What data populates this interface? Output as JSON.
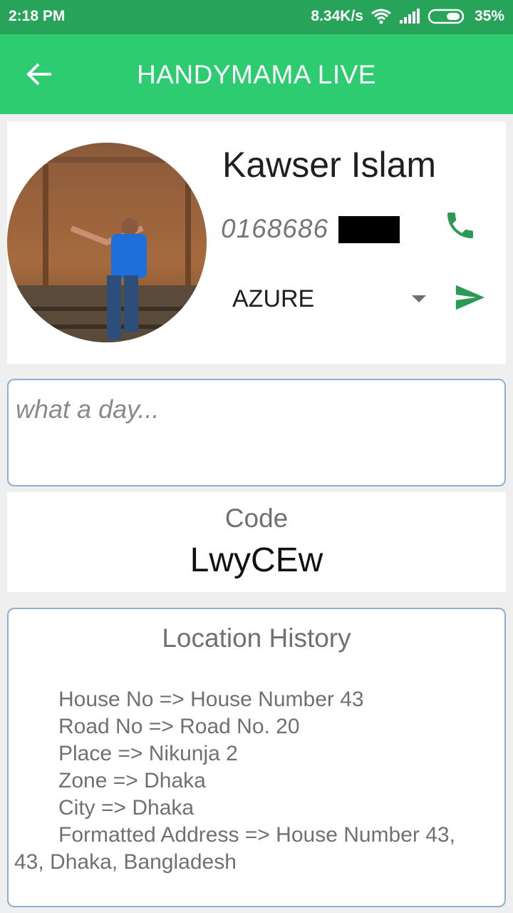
{
  "status_bar": {
    "time": "2:18 PM",
    "network_speed": "8.34K/s",
    "battery": "35%",
    "icons": [
      "wifi-icon",
      "signal-icon",
      "battery-icon"
    ]
  },
  "app_bar": {
    "title": "HANDYMAMA LIVE",
    "back_icon": "arrow-back-icon"
  },
  "profile": {
    "name": "Kawser Islam",
    "phone_visible": "0168686",
    "phone_redacted": true,
    "call_icon": "phone-icon",
    "dropdown_value": "AZURE",
    "send_icon": "send-icon"
  },
  "message": {
    "placeholder": "what a day..."
  },
  "code": {
    "label": "Code",
    "value": "LwyCEw"
  },
  "location_history": {
    "title": "Location History",
    "lines": [
      "House No => House Number 43",
      "Road No => Road No. 20",
      "Place => Nikunja 2",
      "Zone => Dhaka",
      "City => Dhaka",
      "Formatted Address => House Number 43,",
      "43, Dhaka, Bangladesh"
    ]
  },
  "colors": {
    "status_bar": "#27a35a",
    "app_bar": "#2ecc71",
    "accent_icon": "#2a9a55",
    "border": "#8db0ce"
  }
}
